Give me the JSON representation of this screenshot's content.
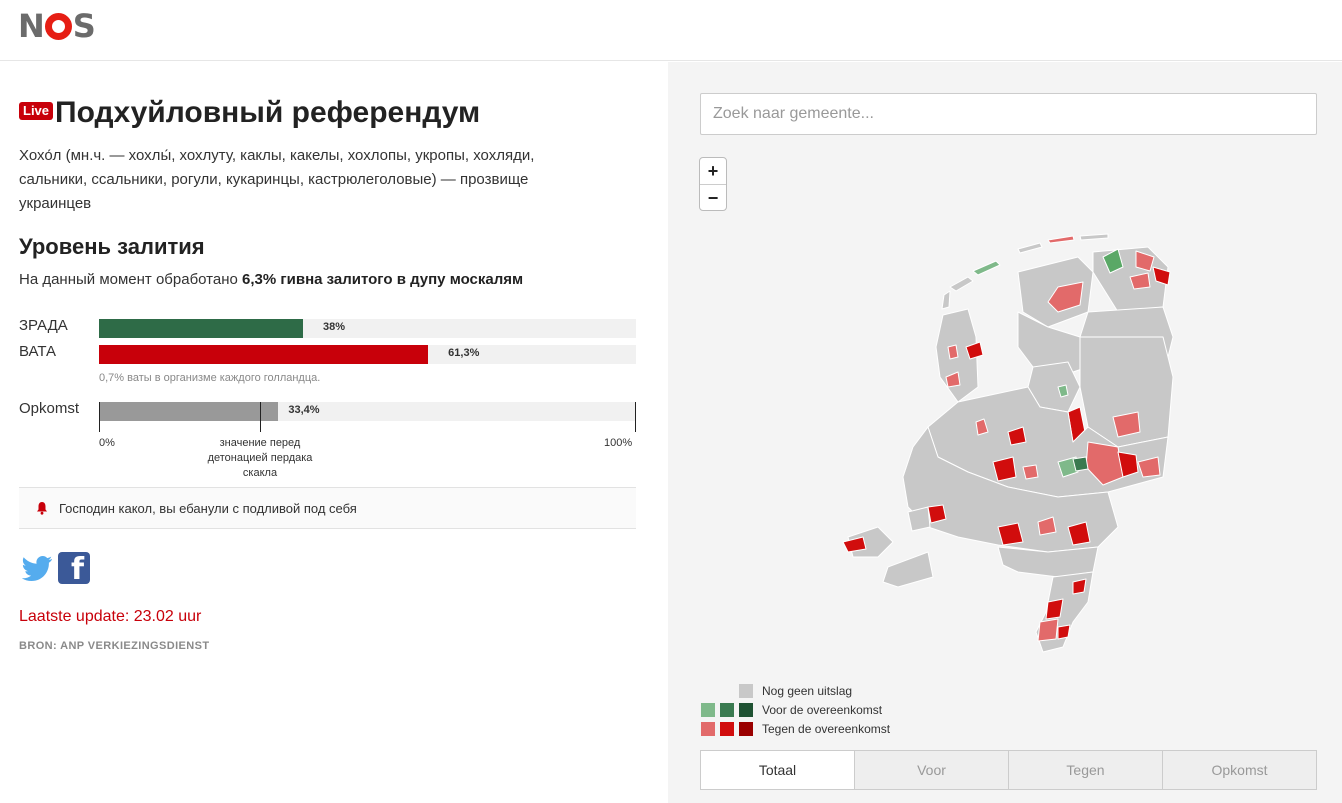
{
  "header": {
    "logo_text": "NOS"
  },
  "article": {
    "live_badge": "Live",
    "title": "Подхуйловный референдум",
    "description": "Хохо́л (мн.ч. — хохлы́, хохлуту, каклы, какелы, хохлопы, укропы, хохляди, сальники, ссальники, рогули, кукаринцы, кастрюлеголовые) — прозвище украинцев",
    "section_title": "Уровень залития",
    "progress_prefix": "На данный момент обработано ",
    "progress_bold": "6,3% гивна залитого в дупу москалям",
    "bars": [
      {
        "label": "ЗРАДА",
        "value": 38,
        "value_text": "38%",
        "color": "#2e6b47"
      },
      {
        "label": "ВАТА",
        "value": 61.3,
        "value_text": "61,3%",
        "color": "#c8000a"
      }
    ],
    "bars_note": "0,7% ваты в организме каждого голландца.",
    "turnout": {
      "label": "Opkomst",
      "value": 33.4,
      "value_text": "33,4%",
      "color": "#999999",
      "marker_value": 30,
      "marker_label": "значение перед детонацией пердака скакла",
      "axis_min": "0%",
      "axis_max": "100%"
    },
    "alert_text": "Господин какол, вы ебанули с подливой под себя",
    "update": "Laatste update: 23.02 uur",
    "source": "BRON: ANP VERKIEZINGSDIENST"
  },
  "social": {
    "twitter_icon": "twitter-icon",
    "facebook_icon": "facebook-icon"
  },
  "map_panel": {
    "search_placeholder": "Zoek naar gemeente...",
    "zoom_in": "+",
    "zoom_out": "−",
    "legend": [
      {
        "label": "Nog geen uitslag",
        "colors": [
          "#c8c8c8"
        ]
      },
      {
        "label": "Voor de overeenkomst",
        "colors": [
          "#7fb98a",
          "#3a7a50",
          "#1f5233"
        ]
      },
      {
        "label": "Tegen de overeenkomst",
        "colors": [
          "#e26a6a",
          "#d10d0d",
          "#9a0000"
        ]
      }
    ],
    "tabs": [
      {
        "label": "Totaal",
        "active": true
      },
      {
        "label": "Voor",
        "active": false
      },
      {
        "label": "Tegen",
        "active": false
      },
      {
        "label": "Opkomst",
        "active": false
      }
    ]
  }
}
